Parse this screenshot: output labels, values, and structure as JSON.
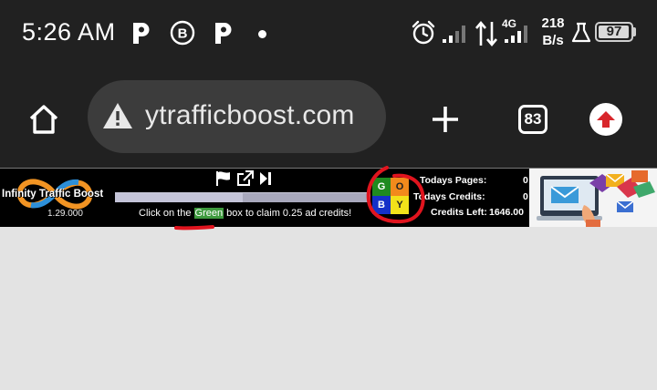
{
  "status_bar": {
    "time": "5:26 AM",
    "notification_icons": [
      "pinterest-icon",
      "bluetooth-b-icon",
      "pinterest-icon",
      "more-dot-icon"
    ],
    "network_type": "4G",
    "speed_value": "218",
    "speed_unit": "B/s",
    "battery": "97",
    "battery_level": 0.97
  },
  "browser": {
    "url": "ytrafficboost.com",
    "tab_count": "83",
    "icons": [
      "home-icon",
      "not-secure-warning-icon",
      "new-tab-plus-icon",
      "tab-switcher-icon",
      "update-arrow-icon"
    ]
  },
  "surfbar": {
    "logo_text": "Infinity Traffic Boost",
    "version": "1.29.000",
    "instruction_prefix": "Click on the ",
    "instruction_highlight": "Green",
    "instruction_suffix": " box to claim 0.25 ad credits!",
    "progress": 0.5,
    "controls": [
      "flag-icon",
      "open-external-icon",
      "skip-next-icon"
    ],
    "color_boxes": [
      {
        "label": "G",
        "color": "#1f8a1f"
      },
      {
        "label": "O",
        "color": "#f28a1c"
      },
      {
        "label": "B",
        "color": "#1530c8"
      },
      {
        "label": "Y",
        "color": "#f2e21a"
      }
    ],
    "stats": {
      "todays_pages_label": "Todays Pages:",
      "todays_pages_value": "0",
      "todays_credits_label": "Todays Credits:",
      "todays_credits_value": "0",
      "credits_left_label": "Credits Left:",
      "credits_left_value": "1646.00"
    }
  },
  "colors": {
    "chrome_bg": "#212121",
    "omnibox_bg": "#3c3c3c",
    "page_bg": "#e3e3e3",
    "annotation_red": "#e0141e"
  }
}
